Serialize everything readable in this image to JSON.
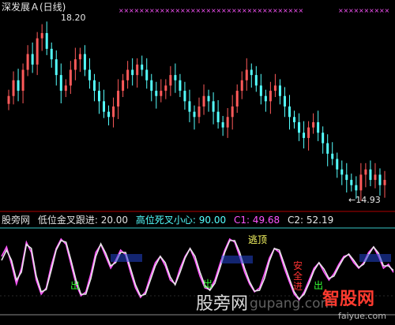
{
  "header": {
    "title": "深发展Ａ(日线)"
  },
  "chart_data": [
    {
      "type": "candlestick",
      "title": "深发展Ａ(日线)",
      "annotations": [
        {
          "label": "18.20",
          "kind": "high"
        },
        {
          "label": "←14.93",
          "kind": "low"
        }
      ],
      "colors": {
        "up": "#ff5a5a",
        "down": "#54ffff",
        "marker": "#ff55ff"
      },
      "closes": [
        16.8,
        17.1,
        16.9,
        17.3,
        17.6,
        17.4,
        17.9,
        18.0,
        17.7,
        17.5,
        17.2,
        16.9,
        17.0,
        17.3,
        17.5,
        17.6,
        17.3,
        17.1,
        16.9,
        16.7,
        16.5,
        16.4,
        16.6,
        16.9,
        17.1,
        17.3,
        17.2,
        17.4,
        17.3,
        17.1,
        16.9,
        16.8,
        16.9,
        17.0,
        17.2,
        17.1,
        16.9,
        16.7,
        16.5,
        16.4,
        16.6,
        16.8,
        16.7,
        16.5,
        16.3,
        16.2,
        16.4,
        16.6,
        16.9,
        17.1,
        17.3,
        17.2,
        17.0,
        16.8,
        16.7,
        16.9,
        17.0,
        16.8,
        16.6,
        16.4,
        16.3,
        16.1,
        16.0,
        16.2,
        16.3,
        16.1,
        15.9,
        15.7,
        15.6,
        15.4,
        15.3,
        15.2,
        15.1,
        15.0,
        15.3,
        15.4,
        15.2,
        15.3,
        15.1,
        15.2
      ]
    },
    {
      "type": "line",
      "title": "股旁网 低位金叉跟进",
      "legend": [
        {
          "text": "股旁网",
          "color": "#e0e0e0"
        },
        {
          "text": "低位金叉跟进: 20.00",
          "color": "#e0e0e0"
        },
        {
          "text": "高位死叉小心: 90.00",
          "color": "#54ffff"
        },
        {
          "text": "C1: 49.68",
          "color": "#ff55ff"
        },
        {
          "text": "C2: 52.19",
          "color": "#e8e8e8"
        }
      ],
      "thresholds": [
        20.0,
        90.0
      ],
      "series": [
        {
          "name": "C1",
          "color": "#ff55ff",
          "values": [
            70,
            82,
            60,
            35,
            55,
            88,
            75,
            40,
            22,
            30,
            58,
            80,
            92,
            85,
            60,
            35,
            20,
            25,
            48,
            75,
            85,
            70,
            55,
            65,
            78,
            72,
            50,
            30,
            18,
            25,
            45,
            62,
            70,
            58,
            40,
            35,
            55,
            70,
            80,
            65,
            45,
            30,
            28,
            40,
            60,
            78,
            92,
            88,
            70,
            50,
            35,
            25,
            30,
            48,
            68,
            80,
            75,
            55,
            38,
            22,
            15,
            25,
            40,
            55,
            62,
            50,
            40,
            48,
            60,
            70,
            72,
            62,
            55,
            62,
            75,
            82,
            70,
            55,
            60,
            49.68
          ]
        },
        {
          "name": "C2",
          "color": "#e8e8e8",
          "values": [
            65,
            78,
            65,
            40,
            50,
            85,
            80,
            45,
            25,
            28,
            52,
            78,
            90,
            88,
            65,
            40,
            22,
            22,
            42,
            70,
            86,
            74,
            58,
            62,
            75,
            75,
            55,
            34,
            20,
            22,
            40,
            58,
            70,
            62,
            44,
            34,
            50,
            68,
            80,
            70,
            50,
            33,
            27,
            36,
            55,
            75,
            90,
            90,
            75,
            55,
            38,
            26,
            27,
            42,
            64,
            80,
            78,
            60,
            42,
            25,
            16,
            22,
            36,
            52,
            62,
            54,
            42,
            45,
            57,
            68,
            73,
            65,
            56,
            60,
            72,
            82,
            74,
            58,
            58,
            52.19
          ]
        }
      ],
      "signals": [
        {
          "text": "逃顶",
          "color": "#ffff66"
        },
        {
          "text": "出",
          "color": "#33ff33"
        },
        {
          "text": "出",
          "color": "#33ff33"
        },
        {
          "text": "安全进",
          "color": "#ff3333"
        },
        {
          "text": "出",
          "color": "#33ff33"
        }
      ]
    }
  ],
  "watermark": {
    "text": "股旁网",
    "url": "gupang.com"
  },
  "logo": {
    "text": "智股网",
    "sub": "faiyue.com"
  }
}
